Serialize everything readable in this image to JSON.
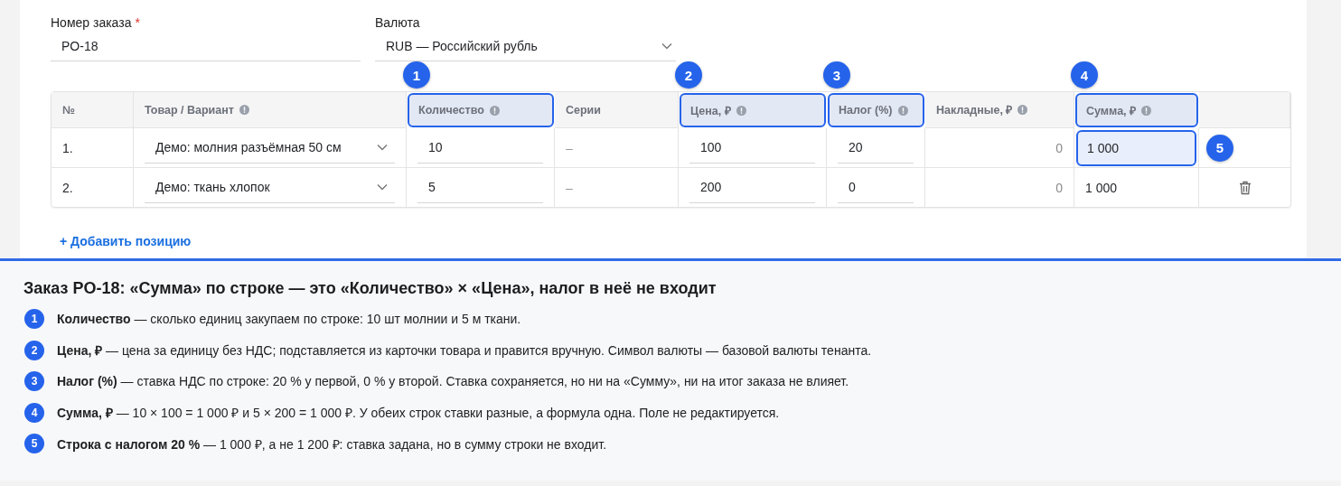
{
  "form": {
    "order_number": {
      "label": "Номер заказа",
      "required_mark": "*",
      "value": "PO-18"
    },
    "currency": {
      "label": "Валюта",
      "value": "RUB — Российский рубль"
    }
  },
  "table": {
    "columns": [
      {
        "label": "№",
        "info": false,
        "highlighted": false
      },
      {
        "label": "Товар / Вариант",
        "info": true,
        "highlighted": false
      },
      {
        "label": "Количество",
        "info": true,
        "highlighted": true,
        "callout": "1"
      },
      {
        "label": "Серии",
        "info": false,
        "highlighted": false
      },
      {
        "label": "Цена, ₽",
        "info": true,
        "highlighted": true,
        "callout": "2"
      },
      {
        "label": "Налог (%)",
        "info": true,
        "highlighted": true,
        "callout": "3"
      },
      {
        "label": "Накладные, ₽",
        "info": true,
        "highlighted": false
      },
      {
        "label": "Сумма, ₽",
        "info": true,
        "highlighted": true,
        "callout": "4"
      }
    ],
    "rows": [
      {
        "number": "1.",
        "product": "Демо: молния разъёмная 50 см",
        "quantity": "10",
        "series": "–",
        "price": "100",
        "tax": "20",
        "overhead": "0",
        "sum": "1 000",
        "sum_highlighted": true,
        "callout": "5"
      },
      {
        "number": "2.",
        "product": "Демо: ткань хлопок",
        "quantity": "5",
        "series": "–",
        "price": "200",
        "tax": "0",
        "overhead": "0",
        "sum": "1 000",
        "sum_highlighted": false
      }
    ]
  },
  "add_line_link": "+ Добавить позицию",
  "explanation": {
    "title": "Заказ PO-18: «Сумма» по строке — это «Количество» × «Цена», налог в неё не входит",
    "items": [
      {
        "number": "1",
        "text": "**Количество** — сколько единиц закупаем по строке: 10 шт молнии и 5 м ткани."
      },
      {
        "number": "2",
        "text": "**Цена, ₽** — цена за единицу без НДС; подставляется из карточки товара и правится вручную. Символ валюты — базовой валюты тенанта."
      },
      {
        "number": "3",
        "text": "**Налог (%)** — ставка НДС по строке: 20 % у первой, 0 % у второй. Ставка сохраняется, но ни на «Сумму», ни на итог заказа не влияет."
      },
      {
        "number": "4",
        "text": "**Сумма, ₽** — 10 × 100 = 1 000 ₽ и 5 × 200 = 1 000 ₽. У обеих строк ставки разные, а формула одна. Поле не редактируется."
      },
      {
        "number": "5",
        "text": "**Строка с налогом 20 %** — 1 000 ₽, а не 1 200 ₽: ставка задана, но в сумму строки не входит."
      }
    ]
  }
}
